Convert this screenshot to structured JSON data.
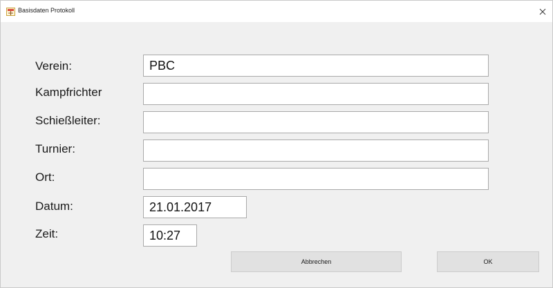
{
  "window": {
    "title": "Basisdaten Protokoll",
    "icon": "app-icon",
    "close_icon": "close-icon"
  },
  "form": {
    "verein": {
      "label": "Verein:",
      "value": "PBC"
    },
    "kampfrichter": {
      "label": "Kampfrichter",
      "value": ""
    },
    "schiessleiter": {
      "label": "Schießleiter:",
      "value": ""
    },
    "turnier": {
      "label": "Turnier:",
      "value": ""
    },
    "ort": {
      "label": "Ort:",
      "value": ""
    },
    "datum": {
      "label": "Datum:",
      "value": "21.01.2017"
    },
    "zeit": {
      "label": "Zeit:",
      "value": "10:27"
    }
  },
  "buttons": {
    "cancel_label": "Abbrechen",
    "ok_label": "OK"
  }
}
